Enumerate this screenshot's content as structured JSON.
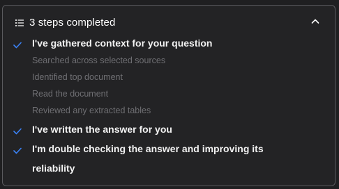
{
  "header": {
    "title": "3 steps completed",
    "icon": "list-icon",
    "toggle_icon": "chevron-up-icon"
  },
  "steps": [
    {
      "label": "I've gathered context for your question",
      "status": "done",
      "substeps": [
        "Searched across selected sources",
        "Identified top document",
        "Read the document",
        "Reviewed any extracted tables"
      ]
    },
    {
      "label": "I've written the answer for you",
      "status": "done"
    },
    {
      "label": "I'm double checking the answer and improving its reliability",
      "status": "done"
    }
  ],
  "colors": {
    "background": "#1f1f21",
    "panel": "#232325",
    "border": "#5a5a5e",
    "check": "#3b82f6",
    "text": "#f2f2f2",
    "muted": "#6f6f73"
  }
}
